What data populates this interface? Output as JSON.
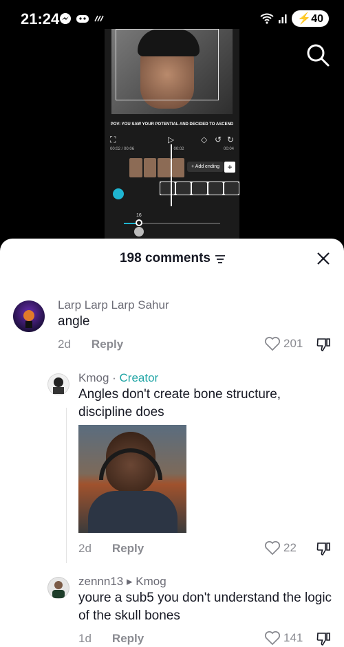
{
  "status_bar": {
    "time": "21:24",
    "battery": "40"
  },
  "video": {
    "caption": "POV: YOU SAW YOUR POTENTIAL AND DECIDED TO ASCEND",
    "time_current": "00:02 / 00:06",
    "time_mid": "00:02",
    "time_end": "00:04",
    "add_ending": "+ Add ending",
    "slider_value": "16"
  },
  "sheet": {
    "title": "198 comments"
  },
  "comments": [
    {
      "username": "Larp Larp Larp Sahur",
      "text": "angle",
      "age": "2d",
      "reply_label": "Reply",
      "likes": "201"
    },
    {
      "username": "Kmog",
      "badge": "Creator",
      "text": "Angles don't create bone structure, discipline does",
      "age": "2d",
      "reply_label": "Reply",
      "likes": "22"
    },
    {
      "username": "zennn13",
      "reply_to": "Kmog",
      "text": "youre a sub5 you don't understand the logic of the skull bones",
      "age": "1d",
      "reply_label": "Reply",
      "likes": "141"
    }
  ],
  "colors": {
    "accent_teal": "#20a5a5",
    "editor_blue": "#1fb5d1"
  }
}
